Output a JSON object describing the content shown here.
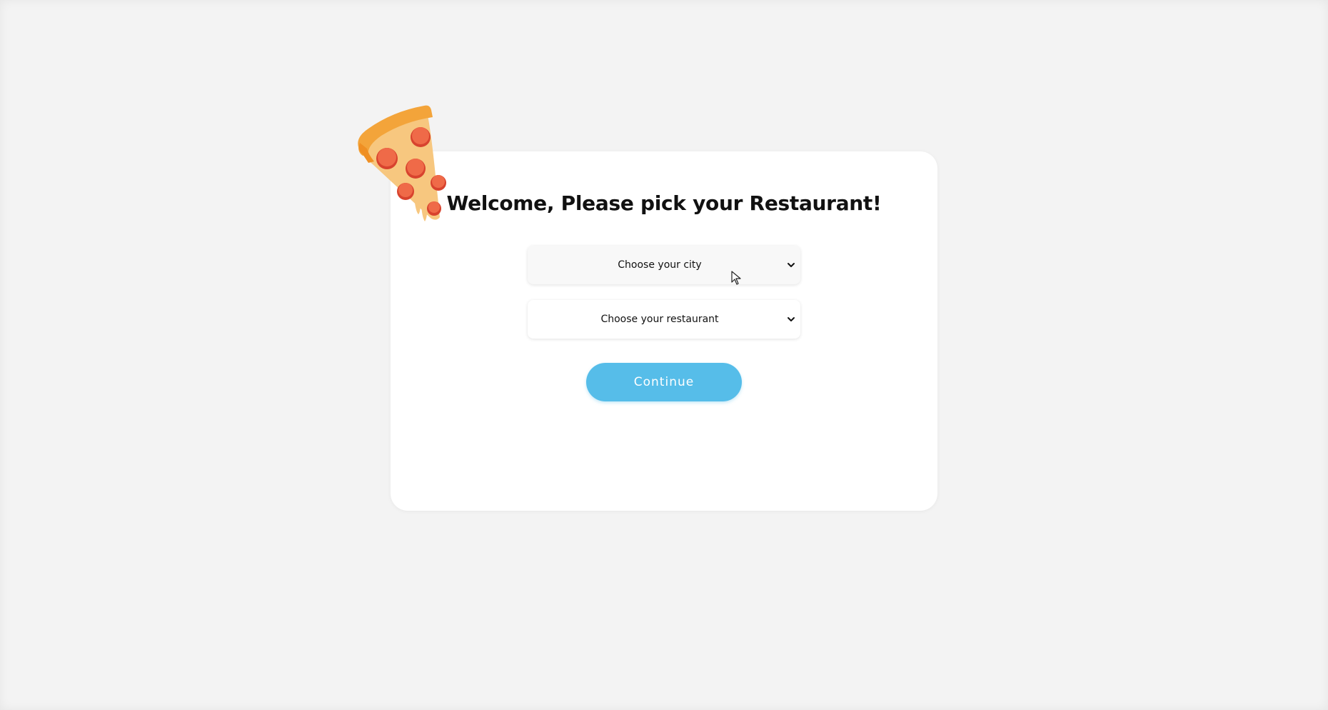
{
  "header": {
    "title": "Welcome, Please pick your Restaurant!"
  },
  "form": {
    "city_select": {
      "selected": "Choose your city"
    },
    "restaurant_select": {
      "selected": "Choose your restaurant"
    },
    "continue_label": "Continue"
  },
  "icons": {
    "logo": "pizza-slice-icon",
    "dropdown": "chevron-down-icon",
    "pointer": "mouse-cursor-icon"
  },
  "colors": {
    "background": "#f3f3f3",
    "card": "#ffffff",
    "button": "#56bde9",
    "button_text": "#ffffff",
    "text": "#111111"
  }
}
